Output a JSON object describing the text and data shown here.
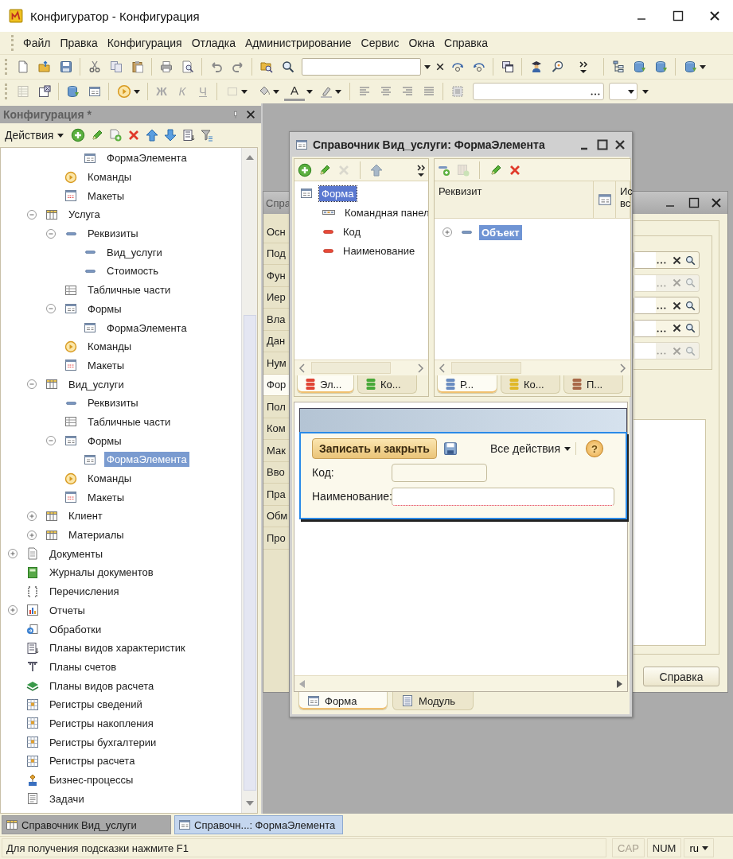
{
  "window": {
    "title": "Конфигуратор - Конфигурация"
  },
  "menu": [
    "Файл",
    "Правка",
    "Конфигурация",
    "Отладка",
    "Администрирование",
    "Сервис",
    "Окна",
    "Справка"
  ],
  "format_buttons": [
    {
      "label": "Ж",
      "kind": "bold",
      "disabled": true
    },
    {
      "label": "К",
      "kind": "italic",
      "disabled": true
    },
    {
      "label": "Ч",
      "kind": "underline",
      "disabled": true
    },
    {
      "label": "A",
      "kind": "color",
      "disabled": false
    }
  ],
  "config_panel": {
    "title": "Конфигурация *",
    "actions_label": "Действия",
    "tree": [
      {
        "children": [
          {
            "children": [
              {
                "children": [
                  {
                    "label": "ФормаЭлемента",
                    "kind": "form",
                    "selected": false
                  }
                ]
              },
              {
                "label": "Команды",
                "kind": "commands",
                "selected": false
              },
              {
                "label": "Макеты",
                "kind": "templates",
                "selected": false
              }
            ]
          },
          {
            "label": "Услуга",
            "kind": "catalog",
            "expanded": true,
            "selected": false,
            "children": [
              {
                "label": "Реквизиты",
                "kind": "attributes",
                "expanded": true,
                "selected": false,
                "children": [
                  {
                    "label": "Вид_услуги",
                    "kind": "attribute",
                    "selected": false
                  },
                  {
                    "label": "Стоимость",
                    "kind": "attribute",
                    "selected": false
                  }
                ]
              },
              {
                "label": "Табличные части",
                "kind": "tabular",
                "selected": false
              },
              {
                "label": "Формы",
                "kind": "forms",
                "expanded": true,
                "selected": false,
                "children": [
                  {
                    "label": "ФормаЭлемента",
                    "kind": "form",
                    "selected": false
                  }
                ]
              },
              {
                "label": "Команды",
                "kind": "commands",
                "selected": false
              },
              {
                "label": "Макеты",
                "kind": "templates",
                "selected": false
              }
            ]
          },
          {
            "label": "Вид_услуги",
            "kind": "catalog",
            "expanded": true,
            "selected": false,
            "children": [
              {
                "label": "Реквизиты",
                "kind": "attributes",
                "selected": false
              },
              {
                "label": "Табличные части",
                "kind": "tabular",
                "selected": false
              },
              {
                "label": "Формы",
                "kind": "forms",
                "expanded": true,
                "selected": false,
                "children": [
                  {
                    "label": "ФормаЭлемента",
                    "kind": "form",
                    "selected": true
                  }
                ]
              },
              {
                "label": "Команды",
                "kind": "commands",
                "selected": false
              },
              {
                "label": "Макеты",
                "kind": "templates",
                "selected": false
              }
            ]
          },
          {
            "label": "Клиент",
            "kind": "catalog",
            "expanded": false,
            "selected": false
          },
          {
            "label": "Материалы",
            "kind": "catalog",
            "expanded": false,
            "selected": false
          }
        ]
      },
      {
        "label": "Документы",
        "kind": "documents",
        "expanded": false,
        "selected": false
      },
      {
        "label": "Журналы документов",
        "kind": "journals",
        "selected": false
      },
      {
        "label": "Перечисления",
        "kind": "enums",
        "selected": false
      },
      {
        "label": "Отчеты",
        "kind": "reports",
        "expanded": false,
        "selected": false
      },
      {
        "label": "Обработки",
        "kind": "processing",
        "selected": false
      },
      {
        "label": "Планы видов характеристик",
        "kind": "char-plans",
        "selected": false
      },
      {
        "label": "Планы счетов",
        "kind": "account-plans",
        "selected": false
      },
      {
        "label": "Планы видов расчета",
        "kind": "calc-plans",
        "selected": false
      },
      {
        "label": "Регистры сведений",
        "kind": "registers",
        "selected": false
      },
      {
        "label": "Регистры накопления",
        "kind": "registers",
        "selected": false
      },
      {
        "label": "Регистры бухгалтерии",
        "kind": "registers",
        "selected": false
      },
      {
        "label": "Регистры расчета",
        "kind": "registers",
        "selected": false
      },
      {
        "label": "Бизнес-процессы",
        "kind": "business-processes",
        "selected": false
      },
      {
        "label": "Задачи",
        "kind": "tasks",
        "selected": false
      }
    ]
  },
  "back_window": {
    "title": "Спра",
    "tabs": [
      {
        "label": "Осн",
        "selected": false
      },
      {
        "label": "Под",
        "selected": false
      },
      {
        "label": "Фун",
        "selected": false
      },
      {
        "label": "Иер",
        "selected": false
      },
      {
        "label": "Вла",
        "selected": false
      },
      {
        "label": "Дан",
        "selected": false
      },
      {
        "label": "Нум",
        "selected": false
      },
      {
        "label": "Фор",
        "selected": true
      },
      {
        "label": "Пол",
        "selected": false
      },
      {
        "label": "Ком",
        "selected": false
      },
      {
        "label": "Мак",
        "selected": false
      },
      {
        "label": "Вво",
        "selected": false
      },
      {
        "label": "Пра",
        "selected": false
      },
      {
        "label": "Обм",
        "selected": false
      },
      {
        "label": "Про",
        "selected": false
      }
    ],
    "fields": [
      {
        "disabled": false
      },
      {
        "disabled": true
      },
      {
        "disabled": false
      },
      {
        "disabled": false
      },
      {
        "disabled": true
      }
    ],
    "button": "Справка"
  },
  "front_window": {
    "title": "Справочник Вид_услуги: ФормаЭлемента",
    "elements": {
      "tree": [
        {
          "label": "Форма",
          "kind": "form",
          "selected": true,
          "children": [
            {
              "label": "Командная панел",
              "kind": "command-bar",
              "selected": false
            },
            {
              "label": "Код",
              "kind": "field",
              "selected": false
            },
            {
              "label": "Наименование",
              "kind": "field",
              "selected": false
            }
          ]
        }
      ],
      "tabs": [
        {
          "label": "Эл...",
          "selected": true,
          "color": "#e04434"
        },
        {
          "label": "Ко...",
          "selected": false,
          "color": "#48a838"
        }
      ]
    },
    "attributes": {
      "columns": [
        "Реквизит",
        "Ис вс"
      ],
      "rows": [
        {
          "label": "Объект",
          "expanded": false,
          "selected": true
        }
      ],
      "tabs": [
        {
          "label": "Р...",
          "selected": true,
          "color": "#6a8cc0"
        },
        {
          "label": "Ко...",
          "selected": false,
          "color": "#e0b828"
        },
        {
          "label": "П...",
          "selected": false,
          "color": "#a86848"
        }
      ]
    },
    "preview": {
      "save_button": "Записать и закрыть",
      "all_actions": "Все действия",
      "help": "?",
      "fields": [
        {
          "label": "Код:",
          "required": false
        },
        {
          "label": "Наименование:",
          "required": true
        }
      ]
    },
    "bottom_tabs": [
      {
        "label": "Форма",
        "kind": "form",
        "selected": true
      },
      {
        "label": "Модуль",
        "kind": "module",
        "selected": false
      }
    ]
  },
  "window_tabs": [
    {
      "label": "Справочник Вид_услуги",
      "kind": "catalog",
      "selected": false
    },
    {
      "label": "Справочн...: ФормаЭлемента",
      "kind": "form",
      "selected": true
    }
  ],
  "status_bar": {
    "hint": "Для получения подсказки нажмите F1",
    "indicators": [
      {
        "label": "CAP",
        "on": false
      },
      {
        "label": "NUM",
        "on": true
      }
    ],
    "language": "ru"
  }
}
